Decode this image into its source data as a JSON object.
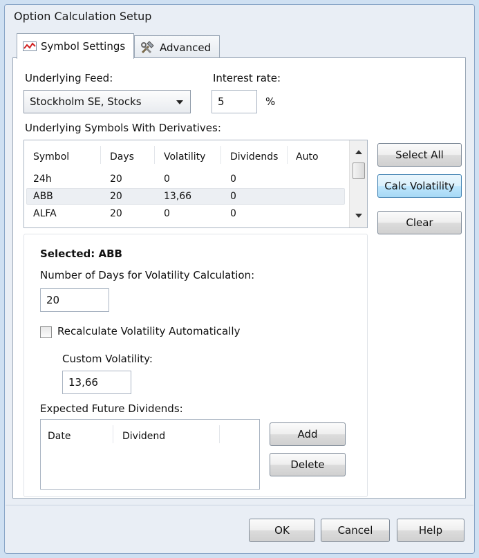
{
  "window": {
    "title": "Option Calculation Setup"
  },
  "tabs": [
    {
      "label": "Symbol Settings",
      "icon": "chart-line-icon",
      "active": true
    },
    {
      "label": "Advanced",
      "icon": "tools-icon",
      "active": false
    }
  ],
  "feed": {
    "label": "Underlying Feed:",
    "value": "Stockholm SE, Stocks"
  },
  "interest": {
    "label": "Interest rate:",
    "value": "5",
    "unit": "%"
  },
  "symbols_list": {
    "label": "Underlying Symbols With Derivatives:",
    "columns": [
      "Symbol",
      "Days",
      "Volatility",
      "Dividends",
      "Auto"
    ],
    "rows": [
      {
        "symbol": "24h",
        "days": "20",
        "volatility": "0",
        "dividends": "0",
        "auto": ""
      },
      {
        "symbol": "ABB",
        "days": "20",
        "volatility": "13,66",
        "dividends": "0",
        "auto": ""
      },
      {
        "symbol": "ALFA",
        "days": "20",
        "volatility": "0",
        "dividends": "0",
        "auto": ""
      }
    ],
    "selected_row": 1
  },
  "side_buttons": {
    "select_all": "Select All",
    "calc_volatility": "Calc Volatility",
    "clear": "Clear"
  },
  "selected_panel": {
    "title": "Selected: ABB",
    "days_label": "Number of Days for Volatility Calculation:",
    "days_value": "20",
    "recalc_label": "Recalculate Volatility Automatically",
    "recalc_checked": false,
    "custom_vol_label": "Custom Volatility:",
    "custom_vol_value": "13,66",
    "dividends_label": "Expected Future Dividends:",
    "dividends_columns": [
      "Date",
      "Dividend"
    ],
    "add_label": "Add",
    "delete_label": "Delete"
  },
  "footer": {
    "ok": "OK",
    "cancel": "Cancel",
    "help": "Help"
  }
}
